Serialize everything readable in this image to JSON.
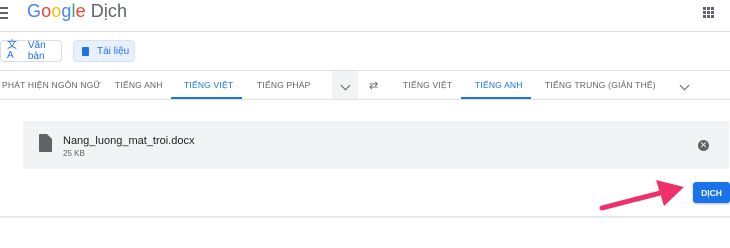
{
  "header": {
    "logo_letters": [
      "G",
      "o",
      "o",
      "g",
      "l",
      "e"
    ],
    "product": "Dịch",
    "menu_icon": "hamburger-menu-icon",
    "apps_icon": "apps-grid-icon"
  },
  "modes": {
    "text_label": "Văn bản",
    "docs_label": "Tài liệu",
    "selected": "docs"
  },
  "source_langs": {
    "items": [
      "PHÁT HIỆN NGÔN NGỮ",
      "TIẾNG ANH",
      "TIẾNG VIỆT",
      "TIẾNG PHÁP"
    ],
    "selected": "TIẾNG VIỆT"
  },
  "target_langs": {
    "items": [
      "TIẾNG VIỆT",
      "TIẾNG ANH",
      "TIẾNG TRUNG (GIẢN THỂ)"
    ],
    "selected": "TIẾNG ANH"
  },
  "file": {
    "name": "Nang_luong_mat_troi.docx",
    "size": "25 KB"
  },
  "translate_button": "DỊCH",
  "colors": {
    "accent": "#1a73e8",
    "annotation_arrow": "#f0306a"
  }
}
